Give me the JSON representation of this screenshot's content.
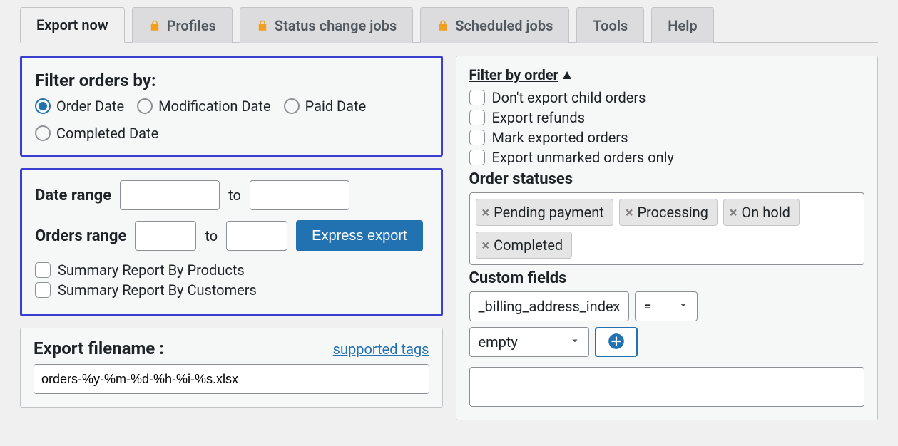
{
  "tabs": {
    "export_now": "Export now",
    "profiles": "Profiles",
    "status_change_jobs": "Status change jobs",
    "scheduled_jobs": "Scheduled jobs",
    "tools": "Tools",
    "help": "Help"
  },
  "filter_orders": {
    "title": "Filter orders by:",
    "options": {
      "order_date": "Order Date",
      "modification_date": "Modification Date",
      "paid_date": "Paid Date",
      "completed_date": "Completed Date"
    }
  },
  "date_range": {
    "label": "Date range",
    "to": "to"
  },
  "orders_range": {
    "label": "Orders range",
    "to": "to",
    "express_export": "Express export"
  },
  "summary": {
    "by_products": "Summary Report By Products",
    "by_customers": "Summary Report By Customers"
  },
  "export_filename": {
    "label": "Export filename :",
    "supported_tags": "supported tags",
    "value": "orders-%y-%m-%d-%h-%i-%s.xlsx"
  },
  "filter_by_order": {
    "title": "Filter by order",
    "dont_export_child": "Don't export child orders",
    "export_refunds": "Export refunds",
    "mark_exported": "Mark exported orders",
    "export_unmarked_only": "Export unmarked orders only"
  },
  "order_statuses": {
    "title": "Order statuses",
    "tags": [
      "Pending payment",
      "Processing",
      "On hold",
      "Completed"
    ]
  },
  "custom_fields": {
    "title": "Custom fields",
    "field": "_billing_address_index",
    "op": "=",
    "value": "empty"
  }
}
